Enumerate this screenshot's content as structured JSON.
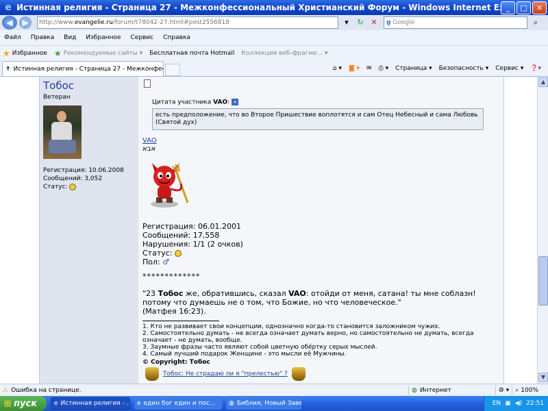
{
  "window": {
    "title": "Истинная религия - Страница 27 - Межконфессиональный Христианский Форум - Windows Internet Explorer"
  },
  "address": {
    "prefix": "http://www.",
    "domain": "evangelie.ru",
    "path": "/forum/t78042-27.html#post2556818",
    "search_placeholder": "Google"
  },
  "menu": [
    "Файл",
    "Правка",
    "Вид",
    "Избранное",
    "Сервис",
    "Справка"
  ],
  "favorites": {
    "label": "Избранное",
    "items": [
      "Рекомендуемые сайты ▾",
      "Бесплатная почта Hotmail",
      "Коллекция веб-фрагме... ▾"
    ]
  },
  "tab": {
    "label": "Истинная религия - Страница 27 - Межконфессион..."
  },
  "commands": {
    "page": "Страница ▾",
    "security": "Безопасность ▾",
    "tools": "Сервис ▾"
  },
  "user": {
    "name": "Тобос",
    "rank": "Ветеран",
    "reg": "Регистрация: 10.06.2008",
    "posts": "Сообщений: 3,052",
    "status": "Статус:"
  },
  "quote": {
    "header": "Цитата участника",
    "author": "VAO",
    "text": "есть предположение, что во Второе Пришествие воплотятся и сам Отец Небесный и сама Любовь (Святой дух)"
  },
  "signature": {
    "link": "VAO",
    "hebrew": "אבא",
    "reg": "Регистрация: 06.01.2001",
    "posts": "Сообщений: 17,558",
    "violations": "Нарушения: 1/1 (2 очков)",
    "status": "Статус:",
    "gender": "Пол:",
    "stars": "*************"
  },
  "verse": {
    "pre": "\"23 ",
    "bold1": "Тобос",
    "mid": " же, обратившись, сказал ",
    "bold2": "VAO",
    "post": ": отойди от меня, сатана! ты мне соблазн! потому что думаешь не о том, что Божие, но что человеческое.\"",
    "ref": "(Матфея 16:23)."
  },
  "rules": [
    "1. Кто не развивает свои концепции, однозначно когда-то становится заложником чужих.",
    "2. Самостоятельно думать - не всегда означает думать верно, но самостоятельно не думать, всегда означает - не думать, вообще.",
    "3. Заумные фразы часто являют собой цветную обёртку серых мыслей.",
    "4. Самый лучший подарок Женщине - это мысли её Мужчины."
  ],
  "copyright": "© Copyright: Тобос",
  "bottom_link": "Тобос: Не страдаю ли я \"прелестью\" ?",
  "statusbar": {
    "message": "Ошибка на странице.",
    "zone": "Интернет",
    "zoom": "100%"
  },
  "taskbar": {
    "start": "пуск",
    "tasks": [
      "Истинная религия - ...",
      "един бог един и пос...",
      "Библия, Новый Заве..."
    ],
    "lang": "EN",
    "time": "22:51"
  }
}
